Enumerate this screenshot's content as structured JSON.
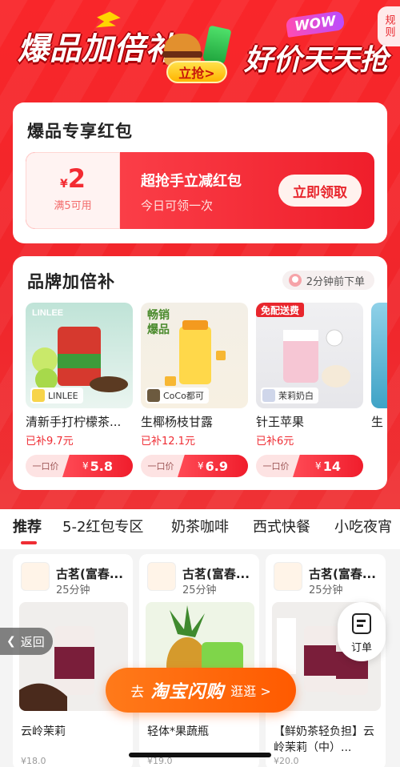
{
  "banner": {
    "left_text": "爆品加倍补",
    "right_text": "好价天天抢",
    "wow": "WOW",
    "grab_button": "立抢>",
    "rules_button": "规则"
  },
  "coupon_section": {
    "title": "爆品专享红包",
    "currency": "¥",
    "amount": "2",
    "condition": "满5可用",
    "name": "超抢手立减红包",
    "subtitle": "今日可领一次",
    "claim_button": "立即领取"
  },
  "brand_section": {
    "title": "品牌加倍补",
    "recent_order": "2分钟前下单",
    "price_label": "一口价",
    "currency": "¥",
    "products": [
      {
        "brand": "LINLEE",
        "name": "清新手打柠檬茶...",
        "subsidy": "已补9.7元",
        "price": "5.8"
      },
      {
        "brand": "CoCo都可",
        "name": "生椰杨枝甘露",
        "subsidy": "已补12.1元",
        "price": "6.9",
        "badge": "畅销爆品"
      },
      {
        "brand": "茉莉奶白",
        "name": "针王苹果",
        "subsidy": "已补6元",
        "price": "14",
        "badge": "免配送费"
      },
      {
        "brand": "",
        "name": "生",
        "subsidy": "",
        "price": ""
      }
    ]
  },
  "tabs": [
    {
      "label": "推荐",
      "active": true
    },
    {
      "label": "5-2红包专区",
      "active": false
    },
    {
      "label": "奶茶咖啡",
      "active": false
    },
    {
      "label": "西式快餐",
      "active": false
    },
    {
      "label": "小吃夜宵",
      "active": false
    }
  ],
  "stores": [
    {
      "name": "古茗(富春...",
      "time": "25分钟",
      "product": "云岭茉莉",
      "price": "¥18.0"
    },
    {
      "name": "古茗(富春...",
      "time": "25分钟",
      "product": "轻体*果蔬瓶",
      "price": "¥19.0"
    },
    {
      "name": "古茗(富春...",
      "time": "25分钟",
      "product": "【鲜奶茶轻负担】云岭茉莉（中）...",
      "price": "¥20.0"
    }
  ],
  "floating": {
    "order_label": "订单",
    "back_label": "返回",
    "flash": {
      "prefix": "去",
      "brand": "淘宝闪购",
      "suffix": "逛逛 >"
    }
  },
  "colors": {
    "primary_red": "#ef2d34",
    "flash_orange": "#ff6a00"
  }
}
